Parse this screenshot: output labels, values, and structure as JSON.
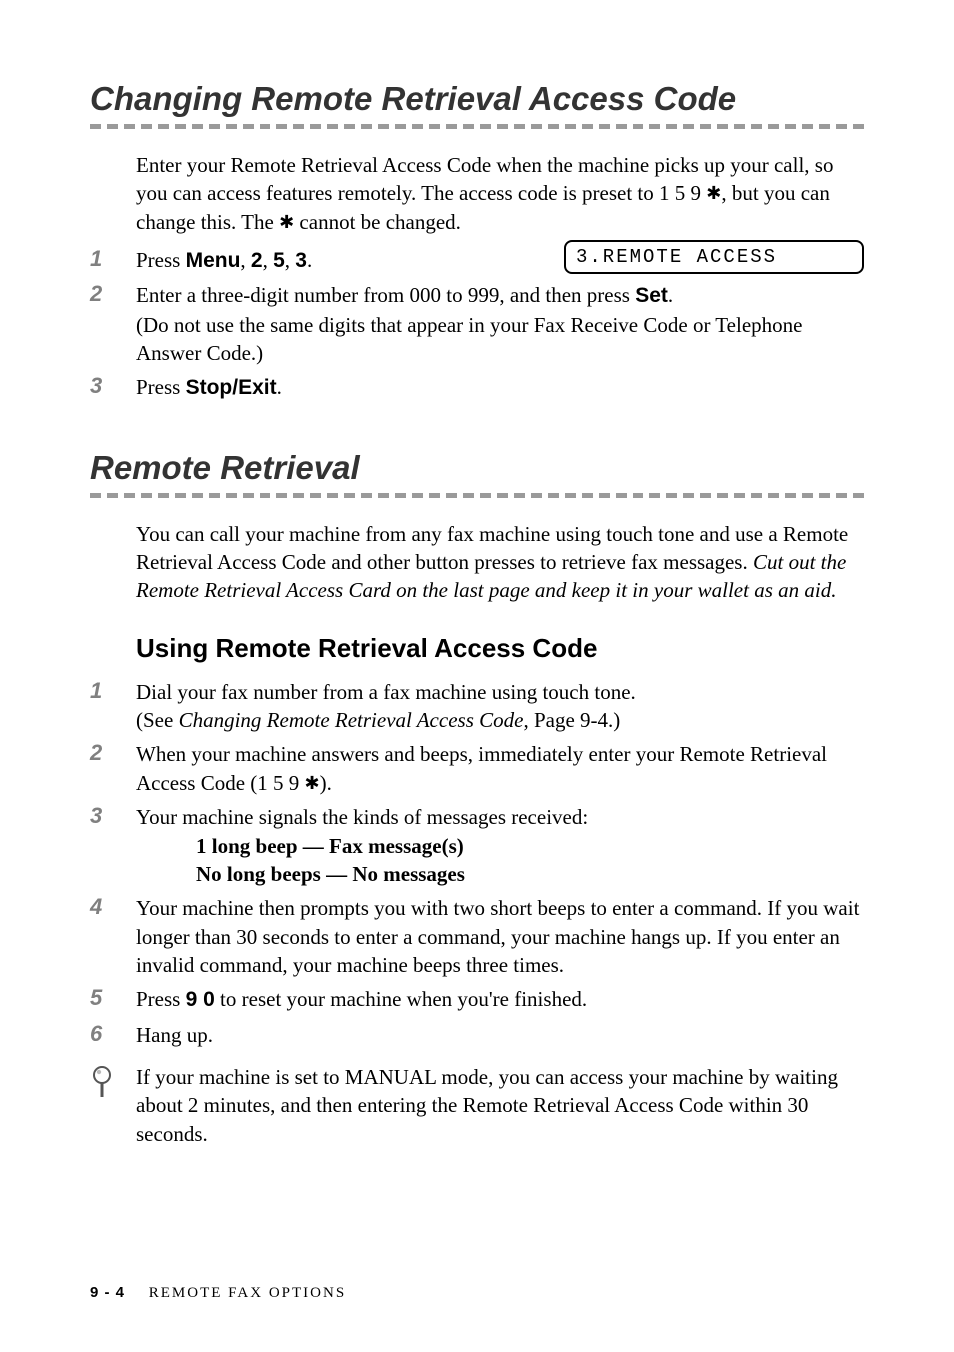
{
  "section1": {
    "title": "Changing Remote Retrieval Access Code",
    "intro_a": "Enter your Remote Retrieval Access Code when the machine picks up your call, so you can access features remotely. The access code is preset to 1 5 9 ",
    "intro_b": ", but you can change this. The ",
    "intro_c": " cannot be changed.",
    "lcd": "3.REMOTE ACCESS",
    "steps": {
      "n1": "1",
      "s1_a": "Press ",
      "s1_menu": "Menu",
      "s1_b": ", ",
      "s1_2": "2",
      "s1_c": ", ",
      "s1_5": "5",
      "s1_d": ", ",
      "s1_3": "3",
      "s1_e": ".",
      "n2": "2",
      "s2_a": "Enter a three-digit number from 000 to 999, and then press ",
      "s2_set": "Set",
      "s2_b": ".",
      "s2_note": "(Do not use the same digits that appear in your Fax Receive Code or Telephone Answer Code.)",
      "n3": "3",
      "s3_a": "Press ",
      "s3_stop": "Stop/Exit",
      "s3_b": "."
    }
  },
  "section2": {
    "title": "Remote Retrieval",
    "intro_a": "You can call your machine from any fax machine using touch tone and use a Remote Retrieval Access Code and other button presses to retrieve fax messages. ",
    "intro_italic": "Cut out the Remote Retrieval Access Card on the last page and keep it in your wallet as an aid.",
    "subhead": "Using Remote Retrieval Access Code",
    "steps": {
      "n1": "1",
      "s1_a": "Dial your fax number from a fax machine using touch tone.",
      "s1_b_a": "(See ",
      "s1_b_i": "Changing Remote Retrieval Access Code",
      "s1_b_b": ", Page 9-4.)",
      "n2": "2",
      "s2_a": "When your machine answers and beeps, immediately enter your Remote Retrieval Access Code (1 5 9 ",
      "s2_b": ").",
      "n3": "3",
      "s3": "Your machine signals the kinds of messages received:",
      "s3_l1": "1 long beep — Fax message(s)",
      "s3_l2": "No long beeps — No messages",
      "n4": "4",
      "s4": "Your machine then prompts you with two short beeps to enter a command.  If you wait longer than 30 seconds to enter a command, your machine hangs up. If you enter an invalid command, your machine beeps three times.",
      "n5": "5",
      "s5_a": "Press ",
      "s5_90": "9 0",
      "s5_b": " to reset your machine when you're finished.",
      "n6": "6",
      "s6": "Hang up."
    },
    "note": "If your machine is set to MANUAL mode, you can access your machine by waiting about 2 minutes, and then entering the Remote Retrieval Access Code within 30 seconds."
  },
  "footer": {
    "page": "9 - 4",
    "chapter": "REMOTE FAX OPTIONS"
  },
  "glyphs": {
    "star": "✱"
  }
}
